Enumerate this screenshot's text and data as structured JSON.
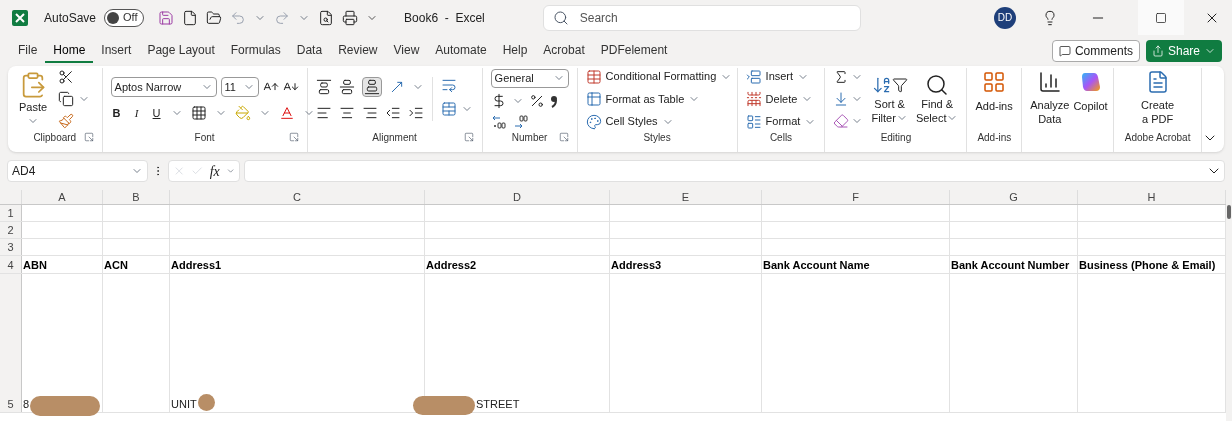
{
  "title_bar": {
    "autosave_label": "AutoSave",
    "autosave": {
      "on": false,
      "label": "Off"
    },
    "document_title": "Book6  -  Excel",
    "search": {
      "placeholder": "Search"
    },
    "avatar": "DD"
  },
  "tabs": [
    {
      "label": "File",
      "selected": false
    },
    {
      "label": "Home",
      "selected": true
    },
    {
      "label": "Insert",
      "selected": false
    },
    {
      "label": "Page Layout",
      "selected": false
    },
    {
      "label": "Formulas",
      "selected": false
    },
    {
      "label": "Data",
      "selected": false
    },
    {
      "label": "Review",
      "selected": false
    },
    {
      "label": "View",
      "selected": false
    },
    {
      "label": "Automate",
      "selected": false
    },
    {
      "label": "Help",
      "selected": false
    },
    {
      "label": "Acrobat",
      "selected": false
    },
    {
      "label": "PDFelement",
      "selected": false
    }
  ],
  "comments_button": "Comments",
  "share_button": "Share",
  "ribbon": {
    "clipboard": {
      "paste": "Paste",
      "label": "Clipboard"
    },
    "font": {
      "name": "Aptos Narrow",
      "size": "11",
      "bold": "B",
      "italic": "I",
      "underline": "U",
      "label": "Font"
    },
    "alignment": {
      "label": "Alignment"
    },
    "number": {
      "format": "General",
      "label": "Number"
    },
    "styles": {
      "items": [
        "Conditional Formatting",
        "Format as Table",
        "Cell Styles"
      ],
      "label": "Styles"
    },
    "cells": {
      "items": [
        "Insert",
        "Delete",
        "Format"
      ],
      "label": "Cells"
    },
    "editing": {
      "sort": "Sort &",
      "sort2": "Filter",
      "find": "Find &",
      "find2": "Select",
      "label": "Editing"
    },
    "addins": {
      "button": "Add-ins",
      "label": "Add-ins"
    },
    "analyze": {
      "button": "Analyze",
      "button2": "Data",
      "copilot": "Copilot"
    },
    "acrobat": {
      "button": "Create",
      "button2": "a PDF",
      "label": "Adobe Acrobat"
    }
  },
  "formula_bar": {
    "name_box": "AD4",
    "fx": "fx"
  },
  "sheet": {
    "columns": [
      "A",
      "B",
      "C",
      "D",
      "E",
      "F",
      "G",
      "H"
    ],
    "rows": [
      {
        "number": "1",
        "cells": {}
      },
      {
        "number": "2",
        "cells": {}
      },
      {
        "number": "3",
        "cells": {}
      },
      {
        "number": "4",
        "bold": true,
        "cells": {
          "A": {
            "text": "ABN"
          },
          "B": {
            "text": "ACN"
          },
          "C": {
            "text": "Address1"
          },
          "D": {
            "text": "Address2"
          },
          "E": {
            "text": "Address3"
          },
          "F": {
            "text": "Bank Account Name"
          },
          "G": {
            "text": "Bank Account Number"
          },
          "H": {
            "text": "Business (Phone & Email)"
          }
        }
      },
      {
        "number": "5",
        "bold": false,
        "cells": {
          "A": {
            "text": "8",
            "redacted": true
          },
          "C": {
            "text": "UNIT",
            "redacted": true
          },
          "D": {
            "text": "STREET",
            "redacted": true
          }
        }
      }
    ]
  }
}
